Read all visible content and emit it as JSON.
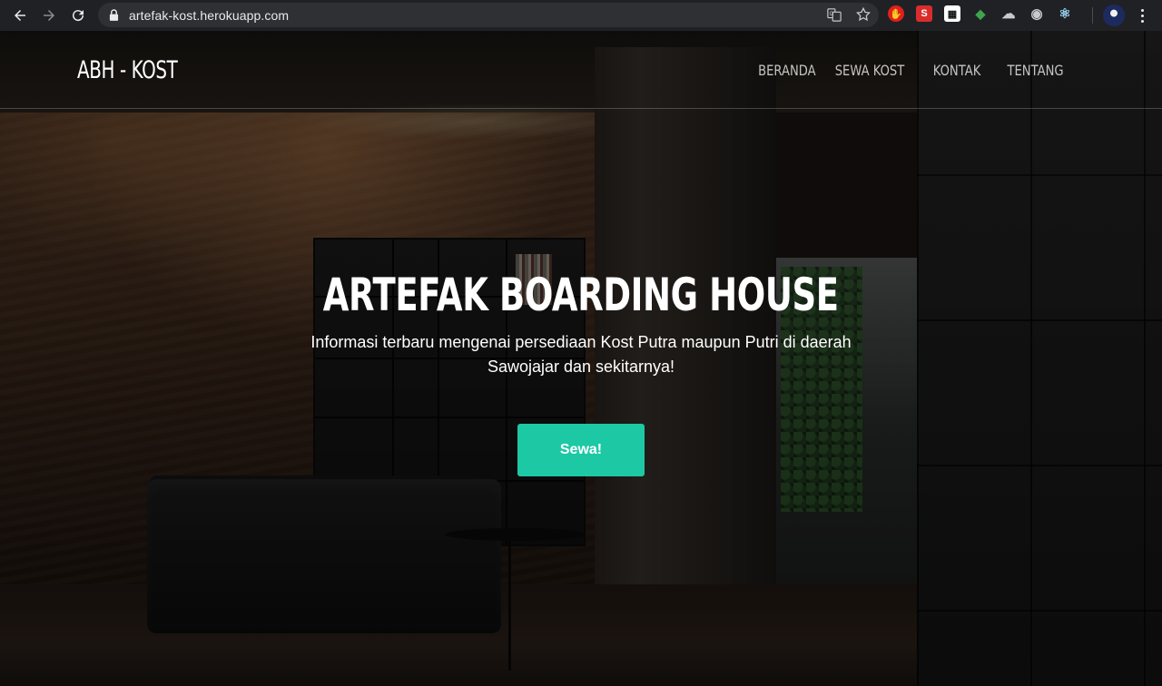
{
  "browser": {
    "url": "artefak-kost.herokuapp.com",
    "buttons": {
      "back": "back-arrow-icon",
      "forward": "forward-arrow-icon",
      "reload": "reload-icon"
    },
    "omnibox_icons": [
      "translate-icon",
      "bookmark-star-icon"
    ],
    "extensions": [
      {
        "name": "adblock-extension-icon",
        "glyph": "✋",
        "color": "#e0201c"
      },
      {
        "name": "s-extension-icon",
        "glyph": "S",
        "color": "#d92d2d"
      },
      {
        "name": "qr-code-extension-icon",
        "glyph": "▦",
        "color": "#ffffff"
      },
      {
        "name": "map-extension-icon",
        "glyph": "◆",
        "color": "#3fa34d"
      },
      {
        "name": "cloud-extension-icon",
        "glyph": "☁",
        "color": "#c8cacd"
      },
      {
        "name": "circle-extension-icon",
        "glyph": "◉",
        "color": "#c8cacd"
      },
      {
        "name": "react-devtools-icon",
        "glyph": "⚛",
        "color": "#9ad3f0"
      }
    ]
  },
  "site": {
    "brand": "ABH - KOST",
    "nav": [
      "BERANDA",
      "SEWA KOST",
      "KONTAK",
      "TENTANG"
    ],
    "hero": {
      "title": "ARTEFAK BOARDING HOUSE",
      "subtitle": "Informasi terbaru mengenai persediaan Kost Putra maupun Putri di daerah Sawojajar dan sekitarnya!",
      "cta": "Sewa!"
    },
    "colors": {
      "accent": "#1cc9a4",
      "text": "#ffffff"
    }
  }
}
